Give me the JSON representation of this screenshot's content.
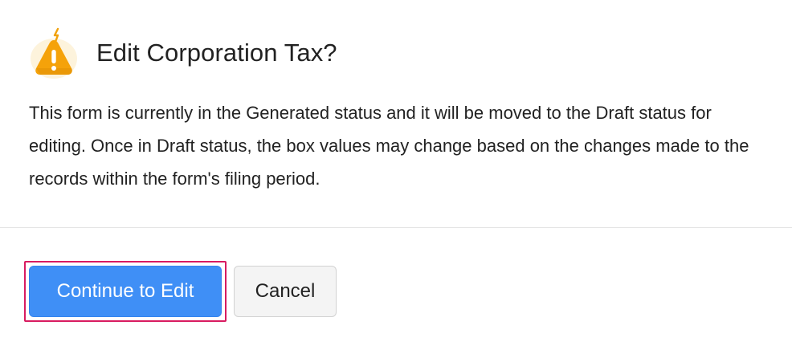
{
  "dialog": {
    "icon": "warning-icon",
    "title": "Edit Corporation Tax?",
    "message": "This form is currently in the Generated status and it will be moved to the Draft status for editing. Once in Draft status, the box values may change based on the changes made to the records within the form's filing period."
  },
  "footer": {
    "continue_label": "Continue to Edit",
    "cancel_label": "Cancel"
  },
  "colors": {
    "primary_button": "#3f8ff6",
    "focus_ring": "#d81b60",
    "warning_icon": "#f5a20a"
  }
}
